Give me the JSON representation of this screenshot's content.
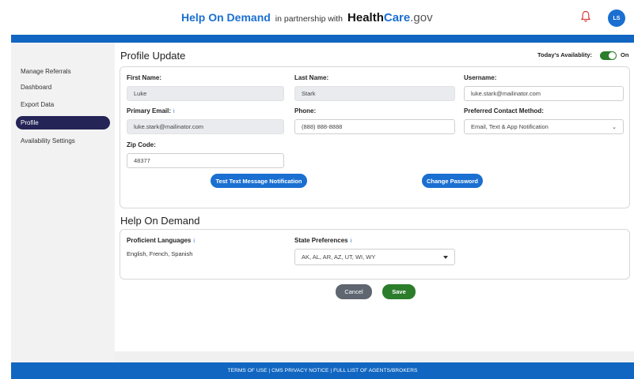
{
  "header": {
    "brand_main": "Help On Demand",
    "brand_partner": "in partnership with",
    "brand_hc_health": "Health",
    "brand_hc_care": "Care",
    "brand_hc_gov": ".gov",
    "avatar_initials": "LS"
  },
  "sidebar": {
    "items": [
      {
        "label": "Manage Referrals"
      },
      {
        "label": "Dashboard"
      },
      {
        "label": "Export Data"
      },
      {
        "label": "Profile",
        "active": true
      },
      {
        "label": "Availability Settings"
      }
    ]
  },
  "profile": {
    "title": "Profile Update",
    "availability_label": "Today's Availablity:",
    "availability_state": "On",
    "first_name_label": "First Name:",
    "first_name": "Luke",
    "last_name_label": "Last Name:",
    "last_name": "Stark",
    "username_label": "Username:",
    "username": "luke.stark@mailinator.com",
    "email_label": "Primary Email:",
    "email_info": "i",
    "email": "luke.stark@mailinator.com",
    "phone_label": "Phone:",
    "phone": "(888) 888-8888",
    "contact_label": "Preferred Contact Method:",
    "contact_value": "Email, Text & App Notification",
    "zip_label": "Zip Code:",
    "zip": "48377",
    "test_button": "Test Text Message Notification",
    "change_password_button": "Change Password"
  },
  "hod": {
    "title": "Help On Demand",
    "languages_label": "Proficient Languages",
    "languages_info": "i",
    "languages": "English, French, Spanish",
    "states_label": "State Preferences",
    "states_info": "i",
    "states": "AK, AL, AR, AZ, UT, WI, WY"
  },
  "actions": {
    "cancel": "Cancel",
    "save": "Save"
  },
  "footer": {
    "text": "TERMS OF USE | CMS PRIVACY NOTICE | FULL LIST OF AGENTS/BROKERS"
  },
  "colors": {
    "brand_blue": "#1a6fd1",
    "bar_blue": "#1166c1",
    "active_nav": "#242457",
    "save_green": "#2b7d2b",
    "cancel_grey": "#5f6670"
  },
  "icons": {
    "notification": "bell-icon",
    "dropdown": "chevron-down-icon",
    "select": "caret-down-icon",
    "info": "info-icon"
  }
}
